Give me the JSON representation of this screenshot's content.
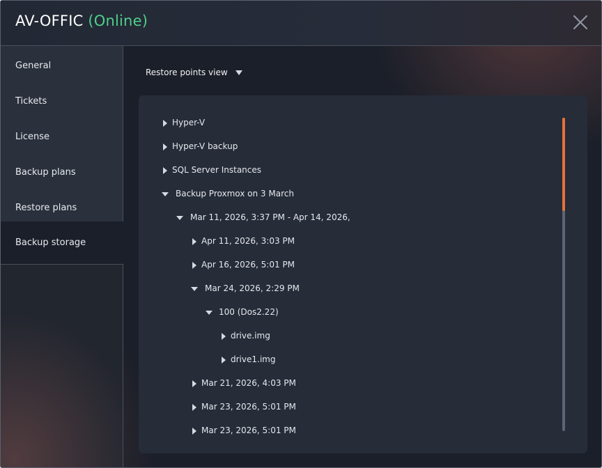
{
  "window": {
    "title": "AV-OFFIC",
    "status": "(Online)",
    "status_color": "#4fcf8a",
    "close_icon": "close-icon"
  },
  "sidebar": {
    "items": [
      {
        "label": "General"
      },
      {
        "label": "Tickets"
      },
      {
        "label": "License"
      },
      {
        "label": "Backup plans"
      },
      {
        "label": "Restore plans"
      },
      {
        "label": "Backup storage",
        "active": true
      }
    ]
  },
  "view_select": {
    "label": "Restore points view",
    "icon": "caret-down-icon"
  },
  "tree": {
    "rows": [
      {
        "label": "Hyper-V",
        "expanded": false,
        "level": 0
      },
      {
        "label": "Hyper-V backup",
        "expanded": false,
        "level": 0
      },
      {
        "label": "SQL Server Instances",
        "expanded": false,
        "level": 0
      },
      {
        "label": "Backup Proxmox on 3 March",
        "expanded": true,
        "level": 0
      },
      {
        "label": "Mar 11, 2026, 3:37 PM - Apr 14, 2026,",
        "expanded": true,
        "level": 1
      },
      {
        "label": "Apr 11, 2026, 3:03 PM",
        "expanded": false,
        "level": 2
      },
      {
        "label": "Apr 16, 2026, 5:01 PM",
        "expanded": false,
        "level": 2
      },
      {
        "label": "Mar 24, 2026, 2:29 PM",
        "expanded": true,
        "level": 2
      },
      {
        "label": "100 (Dos2.22)",
        "expanded": true,
        "level": 3
      },
      {
        "label": "drive.img",
        "expanded": false,
        "level": 4
      },
      {
        "label": "drive1.img",
        "expanded": false,
        "level": 4
      },
      {
        "label": "Mar 21, 2026, 4:03 PM",
        "expanded": false,
        "level": 2
      },
      {
        "label": "Mar 23, 2026, 5:01 PM",
        "expanded": false,
        "level": 2
      },
      {
        "label": "Mar 23, 2026, 5:01 PM",
        "expanded": false,
        "level": 2
      }
    ]
  },
  "scrollbar": {
    "thumb_color": "#e6703a",
    "track_color": "#5d6474"
  }
}
